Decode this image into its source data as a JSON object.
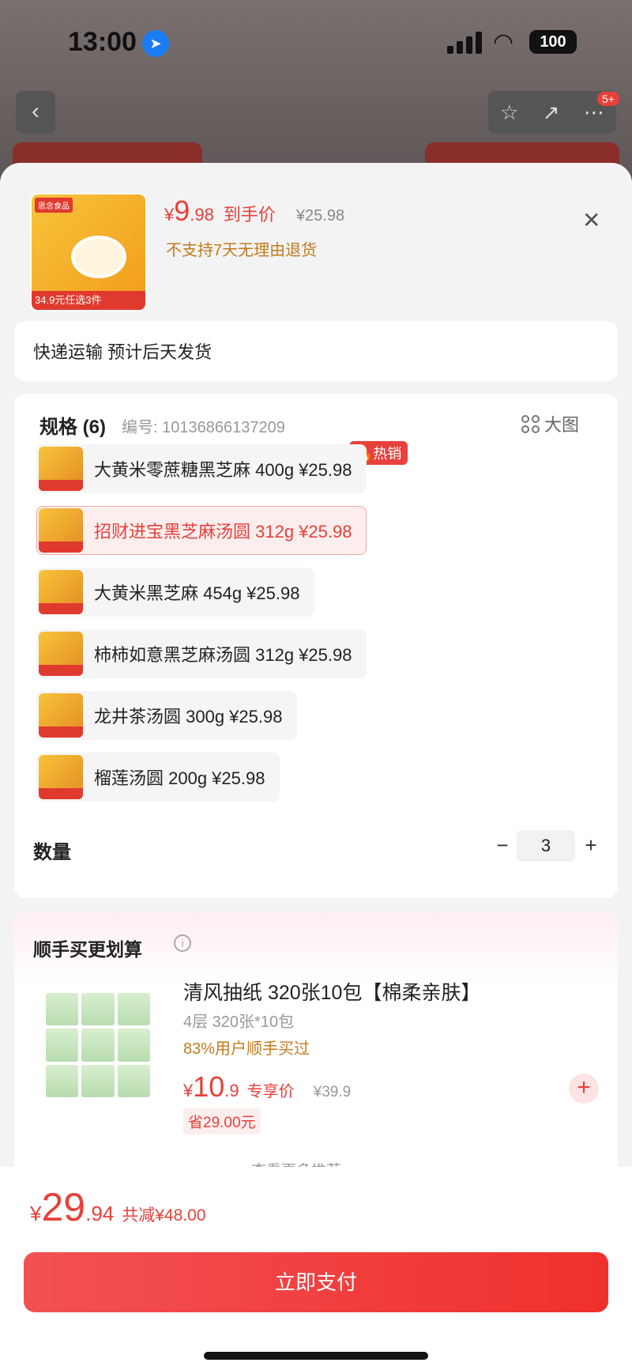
{
  "status_bar": {
    "time": "13:00",
    "battery": "100"
  },
  "nav": {
    "back_icon": "chevron-left-icon",
    "favorite_icon": "star-icon",
    "share_icon": "share-icon",
    "more_icon": "more-icon",
    "badge": "5+"
  },
  "product": {
    "price_yen": "¥",
    "price_int": "9",
    "price_dec": ".98",
    "price_label": "到手价",
    "orig_price": "¥25.98",
    "notice": "不支持7天无理由退货",
    "thumb_tag": "34.9元任选3件",
    "thumb_brand": "思念食品"
  },
  "shipping": {
    "text": "快递运输 预计后天发货"
  },
  "spec": {
    "title": "规格 (6)",
    "code": "编号: 10136866137209",
    "big_view": "大图",
    "hot_badge": "热销",
    "options": [
      {
        "label": "大黄米零蔗糖黑芝麻 400g  ¥25.98"
      },
      {
        "label": "招财进宝黑芝麻汤圆 312g  ¥25.98",
        "selected": true
      },
      {
        "label": "大黄米黑芝麻 454g  ¥25.98"
      },
      {
        "label": "柿柿如意黑芝麻汤圆 312g  ¥25.98"
      },
      {
        "label": "龙井茶汤圆 300g  ¥25.98"
      },
      {
        "label": "榴莲汤圆 200g  ¥25.98"
      }
    ]
  },
  "quantity": {
    "label": "数量",
    "minus": "−",
    "value": "3",
    "plus": "+"
  },
  "addon": {
    "title": "顺手买更划算",
    "name": "清风抽纸 320张10包【棉柔亲肤】",
    "sub": "4层 320张*10包",
    "rate": "83%用户顺手买过",
    "price_yen": "¥",
    "price_int": "10",
    "price_dec": ".9",
    "price_label": "专享价",
    "orig_price": "¥39.9",
    "save": "省29.00元",
    "add": "+",
    "more": "查看更多推荐 ∨"
  },
  "footer": {
    "total_yen": "¥",
    "total_int": "29",
    "total_dec": ".94",
    "total_save": "共减¥48.00",
    "pay_label": "立即支付"
  },
  "colors": {
    "accent": "#e8403a",
    "notice": "#c27b1d",
    "background": "#f3f3f3"
  }
}
